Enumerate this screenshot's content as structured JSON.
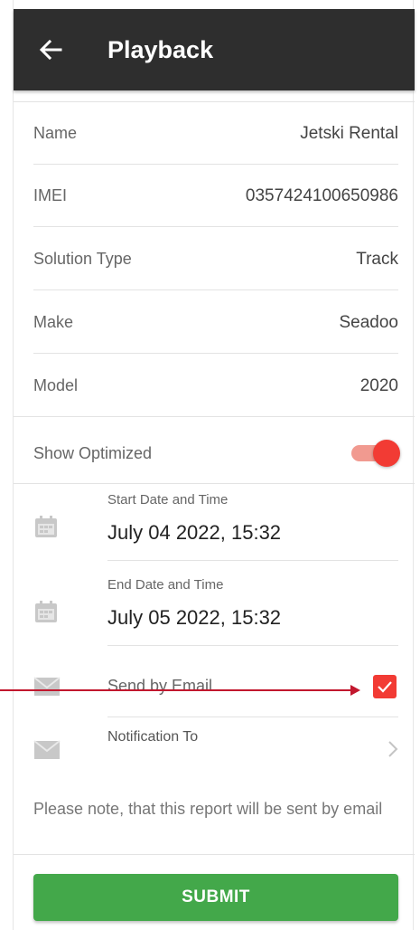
{
  "appbar": {
    "title": "Playback",
    "back_icon": "arrow-left-icon"
  },
  "details": [
    {
      "label": "Name",
      "value": "Jetski Rental"
    },
    {
      "label": "IMEI",
      "value": "0357424100650986"
    },
    {
      "label": "Solution Type",
      "value": "Track"
    },
    {
      "label": "Make",
      "value": "Seadoo"
    },
    {
      "label": "Model",
      "value": "2020"
    }
  ],
  "optimized": {
    "label": "Show Optimized",
    "enabled": true
  },
  "start": {
    "label": "Start Date and Time",
    "value": "July 04 2022, 15:32"
  },
  "end": {
    "label": "End Date and Time",
    "value": "July 05 2022, 15:32"
  },
  "email": {
    "label": "Send by Email",
    "checked": true
  },
  "notification": {
    "label": "Notification To"
  },
  "note": "Please note, that this report will be sent by email",
  "submit_label": "SUBMIT",
  "colors": {
    "accent": "#f23b34",
    "submit": "#43a84a",
    "appbar": "#2e2e2e",
    "annotation": "#c2172e"
  }
}
